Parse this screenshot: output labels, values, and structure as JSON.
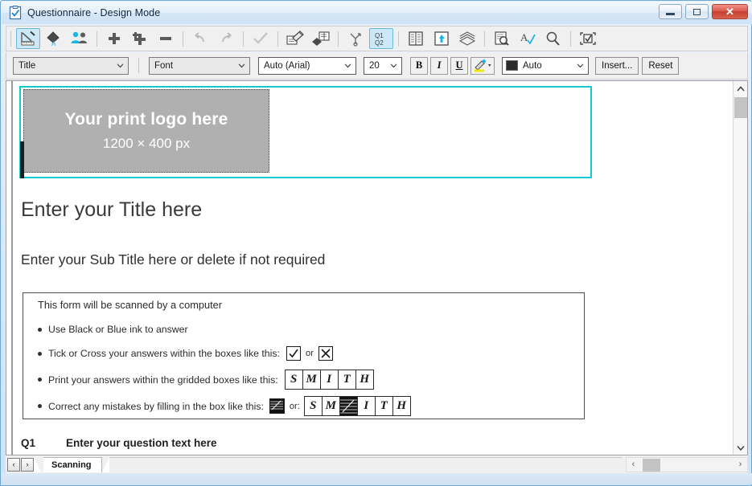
{
  "window": {
    "title": "Questionnaire - Design Mode",
    "icon": "clipboard-check-icon",
    "minimize_label": "Minimize",
    "maximize_label": "Maximize",
    "close_label": "Close",
    "close_glyph": "✕"
  },
  "toolbar_main": {
    "buttons": [
      {
        "name": "design-mode-icon",
        "tooltip": "Design Mode",
        "active": true
      },
      {
        "name": "fill-format-icon",
        "tooltip": "Formatting",
        "active": false
      },
      {
        "name": "respondents-icon",
        "tooltip": "Respondents",
        "active": false
      },
      {
        "name": "add-question-icon",
        "tooltip": "Add Question",
        "active": false
      },
      {
        "name": "add-subquestion-icon",
        "tooltip": "Add Sub Question",
        "active": false
      },
      {
        "name": "remove-question-icon",
        "tooltip": "Remove",
        "active": false
      },
      {
        "name": "undo-icon",
        "tooltip": "Undo",
        "active": false
      },
      {
        "name": "redo-icon",
        "tooltip": "Redo",
        "active": false
      },
      {
        "name": "validate-icon",
        "tooltip": "Validate",
        "active": false
      },
      {
        "name": "edit-page-icon",
        "tooltip": "Edit Page",
        "active": false
      },
      {
        "name": "page-properties-icon",
        "tooltip": "Page Properties",
        "active": false
      },
      {
        "name": "branching-icon",
        "tooltip": "Branching",
        "active": false
      },
      {
        "name": "question-numbering-icon",
        "tooltip": "Q1 Q2 Numbering",
        "active": true
      },
      {
        "name": "grid-layout-icon",
        "tooltip": "Grid Layout",
        "active": false
      },
      {
        "name": "publish-icon",
        "tooltip": "Publish",
        "active": false
      },
      {
        "name": "layers-icon",
        "tooltip": "Layers",
        "active": false
      },
      {
        "name": "print-preview-icon",
        "tooltip": "Print Preview",
        "active": false
      },
      {
        "name": "spell-check-icon",
        "tooltip": "Spell Check",
        "active": false
      },
      {
        "name": "zoom-icon",
        "tooltip": "Zoom",
        "active": false
      },
      {
        "name": "scan-form-icon",
        "tooltip": "Scan Form",
        "active": false
      }
    ]
  },
  "toolbar_format": {
    "style_select": {
      "value": "Title",
      "label": "Style"
    },
    "font_select": {
      "value": "Font",
      "label": "Font group"
    },
    "typeface_select": {
      "value": "Auto (Arial)",
      "label": "Typeface"
    },
    "size_select": {
      "value": "20",
      "label": "Font size"
    },
    "bold_label": "B",
    "italic_label": "I",
    "underline_label": "U",
    "highlight_label": "highlight-pen-icon",
    "color_select": {
      "value": "Auto",
      "label": "Text colour",
      "swatch": "#2b2b2b"
    },
    "insert_button": "Insert...",
    "reset_button": "Reset"
  },
  "document": {
    "logo_placeholder": {
      "line1": "Your print logo here",
      "line2": "1200 × 400 px"
    },
    "title": "Enter your Title here",
    "subtitle": "Enter your Sub Title here or delete if not required",
    "instructions": {
      "heading": "This form will be scanned by a computer",
      "bullets": [
        {
          "text": "Use Black or Blue ink to answer",
          "sample": "none"
        },
        {
          "text": "Tick or Cross your answers within the boxes like this:",
          "sample": "tick-or-cross",
          "joiner": "or"
        },
        {
          "text": "Print your answers within the gridded boxes like this:",
          "sample": "grid-letters"
        },
        {
          "text": "Correct any mistakes by filling in the box like this:",
          "sample": "fill-correction",
          "joiner": "or:"
        }
      ],
      "grid_letters": [
        "S",
        "M",
        "I",
        "T",
        "H"
      ],
      "correction_letters": [
        "S",
        "M",
        "",
        "I",
        "T",
        "H"
      ],
      "tick_glyph": "✓",
      "cross_glyph": "✕"
    },
    "question": {
      "number": "Q1",
      "text": "Enter your question text here"
    }
  },
  "selection": {
    "accent_color": "#13c8cf"
  },
  "bottom": {
    "prev_label": "‹",
    "next_label": "›",
    "tab_label": "Scanning",
    "hscroll_left": "‹",
    "hscroll_right": "›"
  },
  "scrollbar": {
    "up_glyph": "︿",
    "down_glyph": "﹀"
  }
}
